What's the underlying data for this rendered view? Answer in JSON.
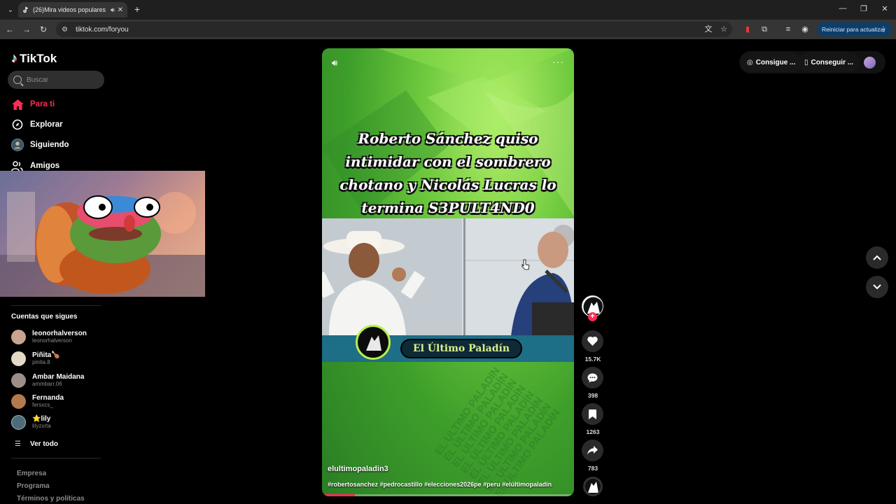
{
  "browser": {
    "tab_title": "(26)Mira videos populares",
    "url": "tiktok.com/foryou",
    "update_button": "Reiniciar para actualizar"
  },
  "sidebar": {
    "logo": "TikTok",
    "search_placeholder": "Buscar",
    "nav": [
      {
        "label": "Para ti",
        "icon": "home-icon",
        "active": true
      },
      {
        "label": "Explorar",
        "icon": "compass-icon"
      },
      {
        "label": "Siguiendo",
        "icon": "following-avatar-icon"
      },
      {
        "label": "Amigos",
        "icon": "friends-icon"
      }
    ],
    "following_title": "Cuentas que sigues",
    "accounts": [
      {
        "name": "leonorhalverson",
        "username": "leonorhalverson",
        "color": "#c9a58f"
      },
      {
        "name": "Piñita🍗",
        "username": "pinita.8",
        "color": "#e5d9c8"
      },
      {
        "name": "Ambar Maidana",
        "username": "ammbarr.06",
        "color": "#9c8f8a"
      },
      {
        "name": "Fernanda",
        "username": "fersxcs_",
        "color": "#b27a4d"
      },
      {
        "name": "⭐lily",
        "username": "lilyzxrta",
        "color": "#4d6b7a"
      }
    ],
    "see_all": "Ver todo",
    "footer": [
      "Empresa",
      "Programa",
      "Términos y políticas"
    ]
  },
  "video": {
    "headline": "Roberto Sánchez quiso intimidar con el sombrero chotano y Nicolás Lucras lo termina S3PULT4ND0",
    "banner": "El Último Paladín",
    "watermark": "EL ÚLTIMO PALADÍN",
    "author": "elultimopaladin3",
    "hashtags": "#robertosanchez #pedrocastillo #elecciones2026pe #peru #elúltimopaladín",
    "progress": 0.13,
    "accent": "#fe2c55"
  },
  "actions": {
    "likes": "15.7K",
    "comments": "398",
    "saves": "1263",
    "shares": "783"
  },
  "header": {
    "get_coins": "Consigue ...",
    "get_app": "Conseguir ..."
  }
}
